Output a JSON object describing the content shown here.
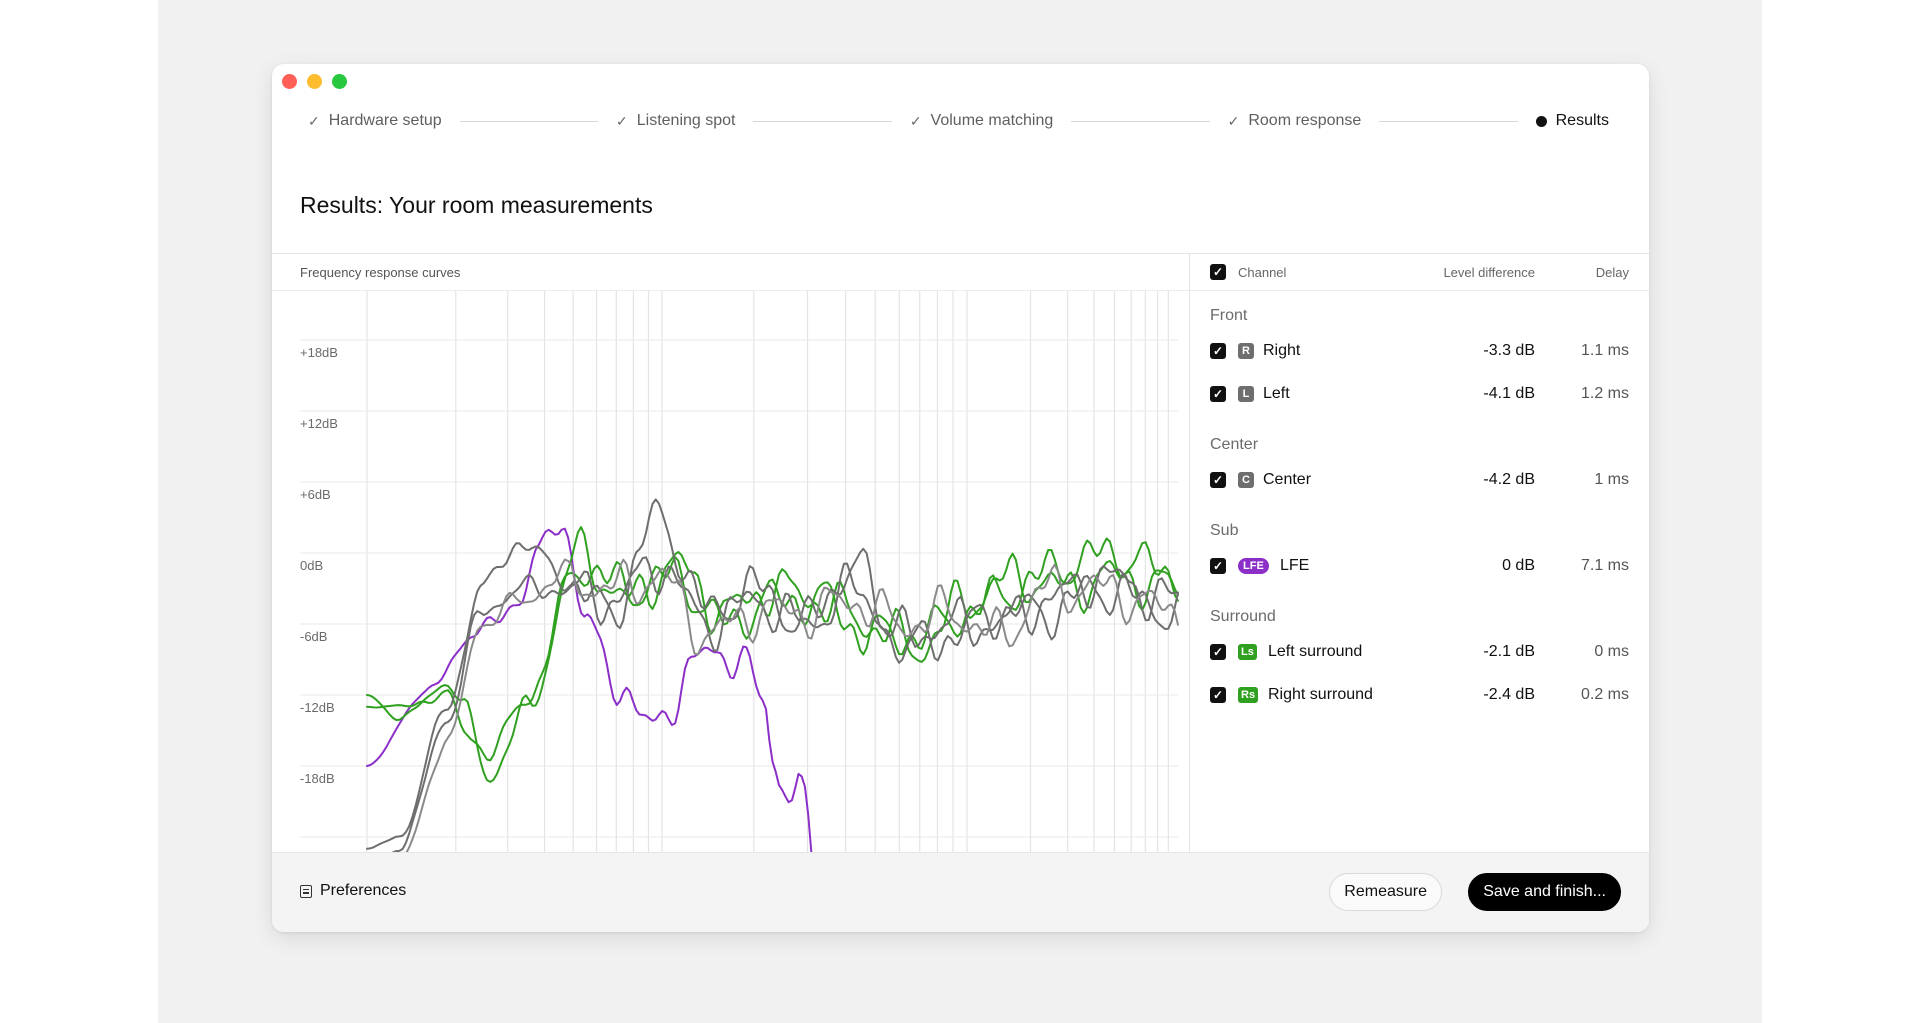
{
  "steps": [
    {
      "label": "Hardware setup",
      "status": "done"
    },
    {
      "label": "Listening spot",
      "status": "done"
    },
    {
      "label": "Volume matching",
      "status": "done"
    },
    {
      "label": "Room response",
      "status": "done"
    },
    {
      "label": "Results",
      "status": "current"
    }
  ],
  "page_title": "Results: Your room measurements",
  "chart": {
    "title": "Frequency response curves",
    "y_labels": [
      "+18dB",
      "+12dB",
      "+6dB",
      "0dB",
      "-6dB",
      "-12dB",
      "-18dB"
    ]
  },
  "chart_data": {
    "type": "line",
    "title": "Frequency response curves",
    "ylim": [
      -24,
      18
    ],
    "y_ticks": [
      "+18dB",
      "+12dB",
      "+6dB",
      "0dB",
      "-6dB",
      "-12dB",
      "-18dB"
    ],
    "x_scale": "log",
    "grid": true,
    "series": [
      {
        "name": "LFE",
        "color": "#8b2fc8",
        "x": [
          0,
          0.07,
          0.13,
          0.19,
          0.21,
          0.24,
          0.27,
          0.3,
          0.35,
          0.38,
          0.41,
          0.44,
          0.47,
          0.49,
          0.5,
          0.51,
          0.53,
          0.54,
          0.55
        ],
        "y": [
          -18,
          -12,
          -7,
          -4,
          0,
          3,
          -6,
          -10,
          -15,
          -12,
          -9,
          -8,
          -10,
          -13,
          -17,
          -19,
          -20,
          -22,
          -26
        ]
      },
      {
        "name": "Left surround",
        "color": "#2fa01f",
        "x": [
          0,
          0.04,
          0.1,
          0.12,
          0.15,
          0.2,
          0.26,
          0.32,
          0.38,
          0.44,
          0.5,
          0.56,
          0.62,
          0.68,
          0.74,
          0.8,
          0.86,
          0.92,
          1.0
        ],
        "y": [
          -12,
          -14,
          -11,
          -13,
          -19,
          -13,
          0,
          -4,
          -1,
          -5,
          -3,
          -4,
          -6,
          -8,
          -4,
          -2,
          -3,
          -2,
          -3
        ]
      },
      {
        "name": "Right surround",
        "color": "#2fa01f",
        "x": [
          0,
          0.04,
          0.1,
          0.12,
          0.15,
          0.2,
          0.26,
          0.32,
          0.38,
          0.44,
          0.5,
          0.56,
          0.62,
          0.68,
          0.74,
          0.8,
          0.86,
          0.92,
          1.0
        ],
        "y": [
          -13,
          -13,
          -12,
          -15,
          -17,
          -12,
          -1,
          -3,
          -2,
          -6,
          -4,
          -4,
          -7,
          -7,
          -5,
          -3,
          -1,
          0,
          -2
        ]
      },
      {
        "name": "Right",
        "color": "#6e6e6e",
        "x": [
          0,
          0.04,
          0.1,
          0.14,
          0.19,
          0.24,
          0.3,
          0.36,
          0.42,
          0.48,
          0.54,
          0.6,
          0.66,
          0.72,
          0.78,
          0.84,
          0.9,
          1.0
        ],
        "y": [
          -25,
          -24,
          -13,
          -3,
          1,
          -2,
          -5,
          3,
          -5,
          -3,
          -6,
          -1,
          -8,
          -7,
          -5,
          -5,
          -3,
          -5
        ]
      },
      {
        "name": "Left",
        "color": "#6e6e6e",
        "x": [
          0,
          0.04,
          0.1,
          0.14,
          0.19,
          0.24,
          0.3,
          0.36,
          0.42,
          0.48,
          0.54,
          0.6,
          0.66,
          0.72,
          0.78,
          0.84,
          0.9,
          1.0
        ],
        "y": [
          -27,
          -25,
          -14,
          -5,
          -3,
          -3,
          -4,
          -1,
          -6,
          -4,
          -6,
          -3,
          -7,
          -6,
          -6,
          -4,
          -2,
          -4
        ]
      },
      {
        "name": "Center",
        "color": "#8a8a8a",
        "x": [
          0,
          0.04,
          0.1,
          0.14,
          0.19,
          0.24,
          0.3,
          0.36,
          0.42,
          0.48,
          0.54,
          0.6,
          0.66,
          0.72,
          0.78,
          0.84,
          0.9,
          1.0
        ],
        "y": [
          -28,
          -26,
          -16,
          -6,
          -4,
          -2,
          -3,
          -2,
          -7,
          -5,
          -5,
          -4,
          -6,
          -5,
          -7,
          -3,
          -3,
          -5
        ]
      }
    ]
  },
  "table": {
    "headers": {
      "channel": "Channel",
      "level": "Level difference",
      "delay": "Delay"
    },
    "groups": [
      {
        "title": "Front",
        "rows": [
          {
            "badge": "R",
            "badge_style": "gray",
            "name": "Right",
            "level": "-3.3 dB",
            "delay": "1.1 ms"
          },
          {
            "badge": "L",
            "badge_style": "gray",
            "name": "Left",
            "level": "-4.1 dB",
            "delay": "1.2 ms"
          }
        ]
      },
      {
        "title": "Center",
        "rows": [
          {
            "badge": "C",
            "badge_style": "gray",
            "name": "Center",
            "level": "-4.2 dB",
            "delay": "1 ms"
          }
        ]
      },
      {
        "title": "Sub",
        "rows": [
          {
            "badge": "LFE",
            "badge_style": "purple",
            "name": "LFE",
            "level": "0 dB",
            "delay": "7.1 ms"
          }
        ]
      },
      {
        "title": "Surround",
        "rows": [
          {
            "badge": "Ls",
            "badge_style": "green",
            "name": "Left surround",
            "level": "-2.1 dB",
            "delay": "0 ms"
          },
          {
            "badge": "Rs",
            "badge_style": "green",
            "name": "Right surround",
            "level": "-2.4 dB",
            "delay": "0.2 ms"
          }
        ]
      }
    ]
  },
  "footer": {
    "preferences_label": "Preferences",
    "remeasure_label": "Remeasure",
    "save_label": "Save and finish..."
  },
  "colors": {
    "accent": "#000000",
    "purple": "#8b2fc8",
    "green": "#2fa01f",
    "gray": "#6e6e6e"
  }
}
